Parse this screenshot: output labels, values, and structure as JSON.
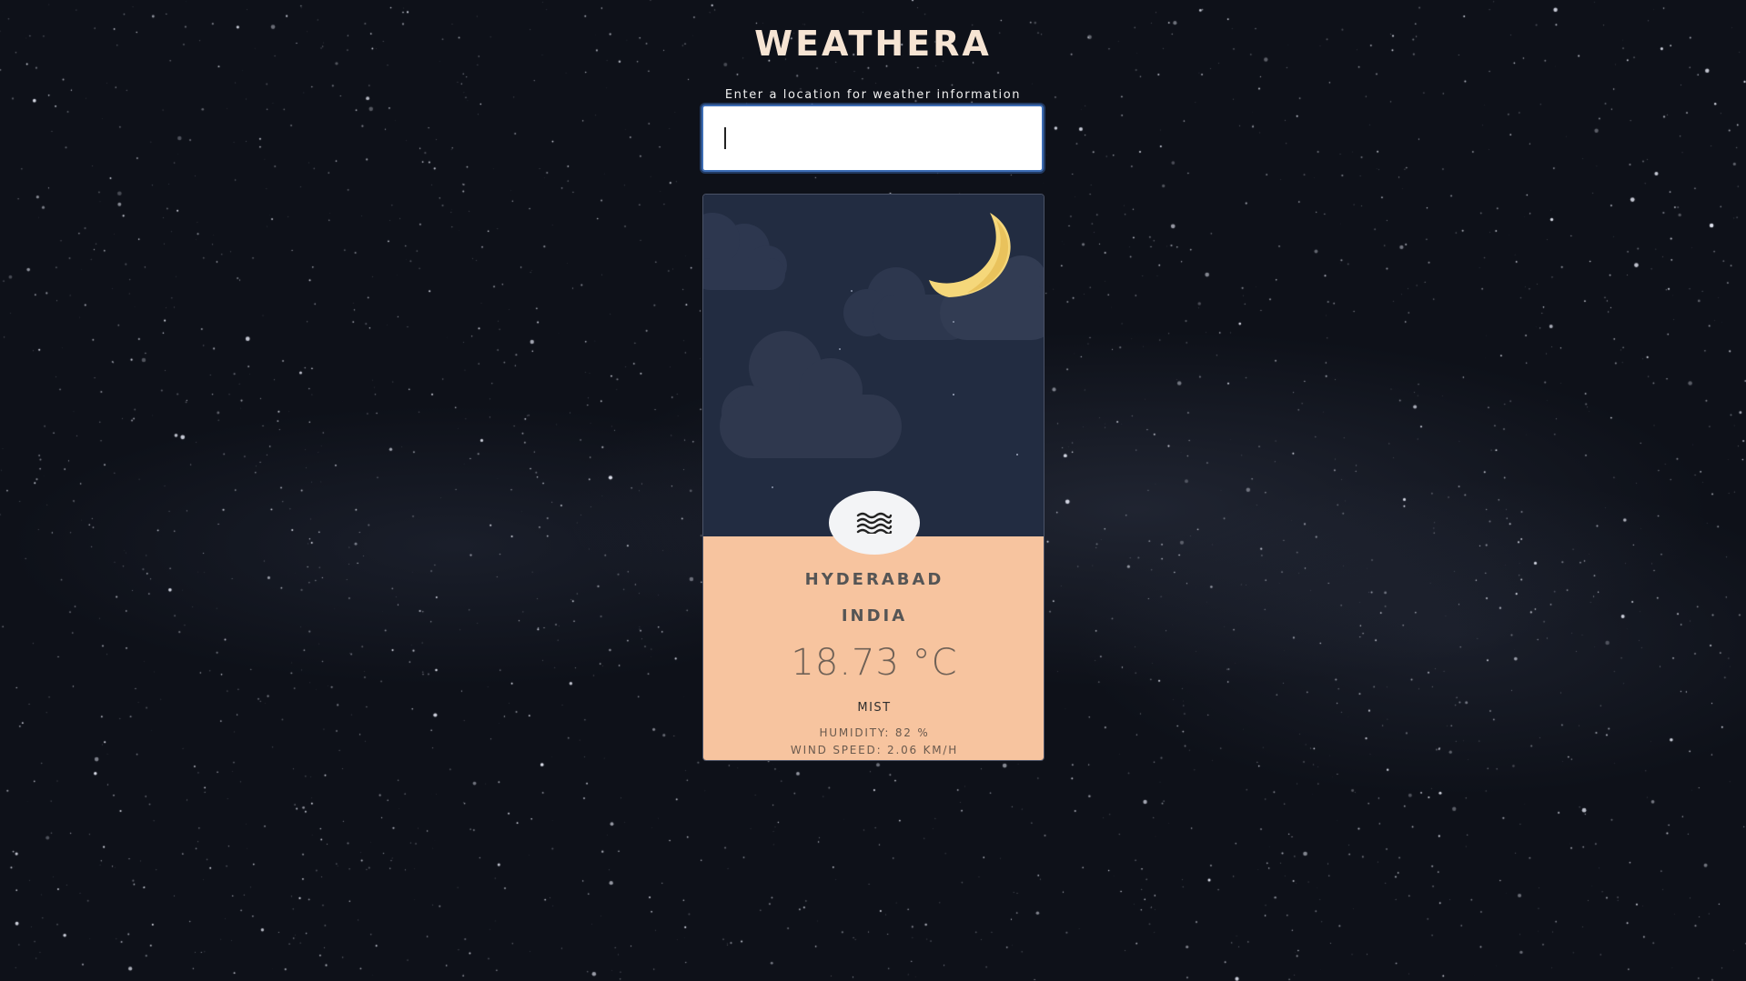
{
  "app": {
    "title": "WEATHERA"
  },
  "search": {
    "label": "Enter a location for weather information",
    "value": "",
    "placeholder": ""
  },
  "weather": {
    "city": "HYDERABAD",
    "country": "INDIA",
    "temperature": "18.73 °C",
    "condition": "MIST",
    "condition_icon": "mist-icon",
    "humidity": "HUMIDITY: 82 %",
    "wind_speed": "WIND SPEED: 2.06 KM/H",
    "time_of_day_icon": "crescent-moon-icon"
  },
  "colors": {
    "background": "#0e1119",
    "title": "#f6e4d3",
    "sky_panel": "#222c41",
    "info_panel": "#f7c49f",
    "moon": "#f5d77a",
    "input_focus": "#3d6db5"
  }
}
